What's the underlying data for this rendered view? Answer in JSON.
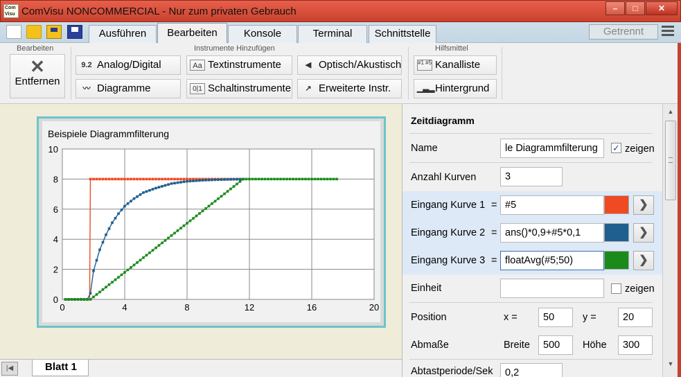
{
  "window": {
    "title": "ComVisu NONCOMMERCIAL - Nur zum privaten Gebrauch",
    "icon_text": "Com Visu",
    "minimize": "–",
    "maximize": "□",
    "close": "✕"
  },
  "tabs": [
    "Ausführen",
    "Bearbeiten",
    "Konsole",
    "Terminal",
    "Schnittstelle"
  ],
  "active_tab": "Bearbeiten",
  "connection_status": "Getrennt",
  "ribbon": {
    "group_edit": "Bearbeiten",
    "remove_label": "Entfernen",
    "group_add": "Instrumente Hinzufügen",
    "analog_digital": "Analog/Digital",
    "analog_icon_text": "9.2",
    "diagramme": "Diagramme",
    "textinstrumente": "Textinstrumente",
    "text_icon_text": "Aa",
    "schaltinstrumente": "Schaltinstrumente",
    "switch_icon_text": "0|1",
    "optisch": "Optisch/Akustisch",
    "erweiterte": "Erweiterte Instr.",
    "group_tools": "Hilfsmittel",
    "kanalliste": "Kanalliste",
    "kanal_icon_text": "#1 #5",
    "hintergrund": "Hintergrund"
  },
  "sheet": {
    "tab_label": "Blatt 1"
  },
  "properties": {
    "header": "Zeitdiagramm",
    "name_label": "Name",
    "name_value": "le Diagrammfilterung",
    "show_label": "zeigen",
    "name_show_checked": true,
    "curves_label": "Anzahl Kurven",
    "curves_value": "3",
    "curve1_label": "Eingang Kurve 1",
    "curve1_value": "#5",
    "curve1_color": "#f04a23",
    "curve2_label": "Eingang Kurve 2",
    "curve2_value": "ans()*0,9+#5*0,1",
    "curve2_color": "#1f5f8f",
    "curve3_label": "Eingang Kurve 3",
    "curve3_value": "floatAvg(#5;50)",
    "curve3_color": "#1a8a1a",
    "equals": "=",
    "unit_label": "Einheit",
    "unit_value": "",
    "unit_show_checked": false,
    "position_label": "Position",
    "x_label": "x =",
    "x_value": "50",
    "y_label": "y =",
    "y_value": "20",
    "size_label": "Abmaße",
    "width_label": "Breite",
    "width_value": "500",
    "height_label": "Höhe",
    "height_value": "300",
    "sample_label": "Abtastperiode/Sek",
    "sample_value": "0,2"
  },
  "chart_data": {
    "type": "line",
    "title": "Beispiele Diagrammfilterung",
    "xlim": [
      0,
      20
    ],
    "ylim": [
      0,
      10
    ],
    "x_ticks": [
      0,
      4,
      8,
      12,
      16,
      20
    ],
    "y_ticks": [
      0,
      2,
      4,
      6,
      8,
      10
    ],
    "grid": true,
    "series": [
      {
        "color": "#f04a23",
        "points": [
          [
            0.2,
            0
          ],
          [
            1.6,
            0
          ],
          [
            1.75,
            0
          ],
          [
            1.8,
            8
          ],
          [
            11.6,
            8
          ]
        ]
      },
      {
        "color": "#1f5f8f",
        "points": [
          [
            0.2,
            0
          ],
          [
            1.6,
            0
          ],
          [
            1.8,
            0.4
          ],
          [
            2.0,
            1.9
          ],
          [
            2.2,
            2.6
          ],
          [
            2.4,
            3.3
          ],
          [
            2.8,
            4.3
          ],
          [
            3.2,
            5.1
          ],
          [
            3.6,
            5.7
          ],
          [
            4.0,
            6.2
          ],
          [
            4.6,
            6.7
          ],
          [
            5.2,
            7.1
          ],
          [
            6.0,
            7.4
          ],
          [
            7.0,
            7.7
          ],
          [
            8.0,
            7.85
          ],
          [
            9.0,
            7.92
          ],
          [
            10.0,
            7.96
          ],
          [
            11.6,
            8.0
          ]
        ]
      },
      {
        "color": "#1a8a1a",
        "points": [
          [
            0.2,
            0
          ],
          [
            1.6,
            0
          ],
          [
            1.8,
            0
          ],
          [
            11.6,
            8
          ],
          [
            17.7,
            8
          ]
        ]
      }
    ]
  }
}
